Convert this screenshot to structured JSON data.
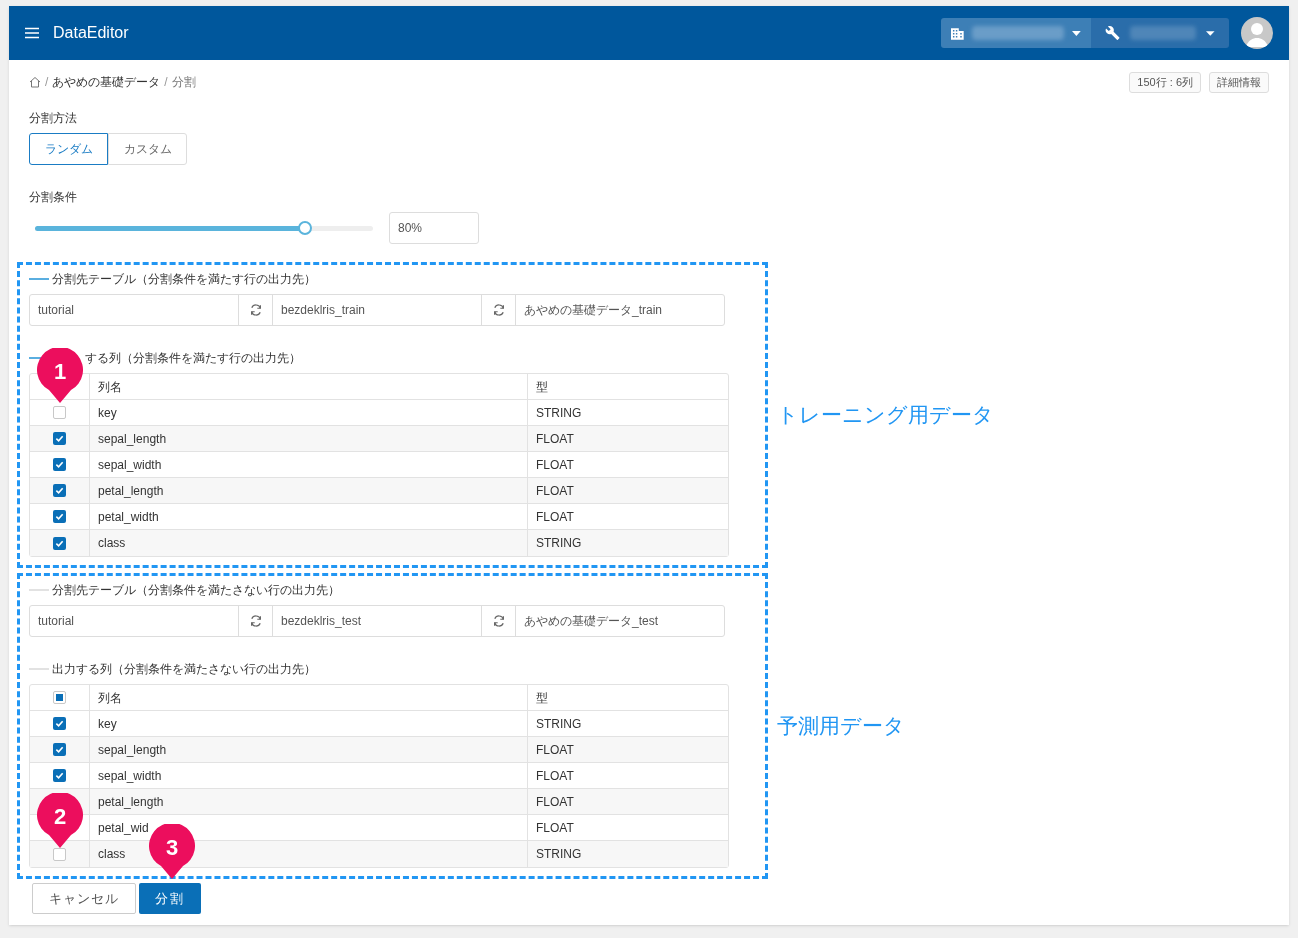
{
  "app": {
    "title": "DataEditor"
  },
  "breadcrumb": [
    {
      "separator": "/",
      "label": "あやめの基礎データ"
    },
    {
      "separator": "/",
      "label": "分割"
    }
  ],
  "info_buttons": [
    "150行 : 6列",
    "詳細情報"
  ],
  "method": {
    "label": "分割方法",
    "options": [
      {
        "label": "ランダム",
        "selected": true
      },
      {
        "label": "カスタム",
        "selected": false
      }
    ]
  },
  "condition": {
    "label": "分割条件",
    "level": 0.8,
    "value": "80%"
  },
  "sections": [
    {
      "accent": true,
      "annotation": "トレーニング用データ",
      "table_heading": "分割先テーブル（分割条件を満たす行の出力先）",
      "fields": [
        "tutorial",
        "bezdeklris_train",
        "あやめの基礎データ_train"
      ],
      "columns_heading": "する列（分割条件を満たす行の出力先）",
      "headers": [
        "列名",
        "型"
      ],
      "rows": [
        {
          "name": "key",
          "type": "STRING",
          "checked": false
        },
        {
          "name": "sepal_length",
          "type": "FLOAT",
          "checked": true
        },
        {
          "name": "sepal_width",
          "type": "FLOAT",
          "checked": true
        },
        {
          "name": "petal_length",
          "type": "FLOAT",
          "checked": true
        },
        {
          "name": "petal_width",
          "type": "FLOAT",
          "checked": true
        },
        {
          "name": "class",
          "type": "STRING",
          "checked": true
        }
      ]
    },
    {
      "accent": false,
      "annotation": "予測用データ",
      "table_heading": "分割先テーブル（分割条件を満たさない行の出力先）",
      "fields": [
        "tutorial",
        "bezdeklris_test",
        "あやめの基礎データ_test"
      ],
      "columns_heading": "出力する列（分割条件を満たさない行の出力先）",
      "headers": [
        "列名",
        "型"
      ],
      "header_indeterminate": true,
      "rows": [
        {
          "name": "key",
          "type": "STRING",
          "checked": true
        },
        {
          "name": "sepal_length",
          "type": "FLOAT",
          "checked": true
        },
        {
          "name": "sepal_width",
          "type": "FLOAT",
          "checked": true
        },
        {
          "name": "petal_length",
          "type": "FLOAT"
        },
        {
          "name": "petal_wid",
          "type": "FLOAT"
        },
        {
          "name": "class",
          "type": "STRING",
          "checked": false
        }
      ]
    }
  ],
  "actions": [
    {
      "label": "キャンセル",
      "kind": "secondary"
    },
    {
      "label": "分割",
      "kind": "primary"
    }
  ],
  "markers": [
    "1",
    "2",
    "3"
  ]
}
